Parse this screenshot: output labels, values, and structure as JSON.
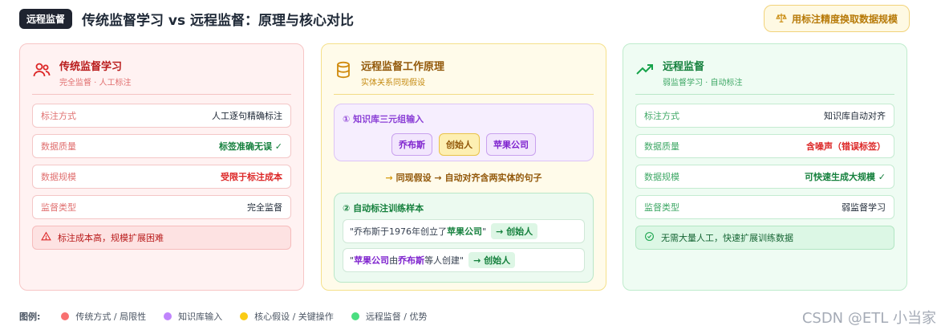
{
  "header": {
    "badge": "远程监督",
    "title": "传统监督学习 vs 远程监督：原理与核心对比",
    "tradeoff": "用标注精度换取数据规模",
    "tradeoff_icon": "scale-icon"
  },
  "traditional": {
    "icon": "users-icon",
    "title": "传统监督学习",
    "subtitle": "完全监督 · 人工标注",
    "rows": [
      {
        "key": "标注方式",
        "value": "人工逐句精确标注",
        "tone": "normal"
      },
      {
        "key": "数据质量",
        "value": "标签准确无误 ✓",
        "tone": "good"
      },
      {
        "key": "数据规模",
        "value": "受限于标注成本",
        "tone": "bad"
      },
      {
        "key": "监督类型",
        "value": "完全监督",
        "tone": "normal"
      }
    ],
    "note": "标注成本高，规模扩展困难"
  },
  "principle": {
    "icon": "database-icon",
    "title": "远程监督工作原理",
    "subtitle": "实体关系同现假设",
    "kb_label": "① 知识库三元组输入",
    "kb_chips": [
      "乔布斯",
      "创始人",
      "苹果公司"
    ],
    "assumption": "同现假设 → 自动对齐含两实体的句子",
    "samples_label": "② 自动标注训练样本",
    "samples": [
      {
        "pre": "\"乔布斯于1976年创立了",
        "ent": "苹果公司",
        "post": "\"",
        "relation": "→ 创始人"
      },
      {
        "pre": "\"",
        "ent": "苹果公司",
        "mid": "由",
        "ent2": "乔布斯",
        "post": "等人创建\"",
        "relation": "→ 创始人"
      }
    ]
  },
  "remote": {
    "icon": "trend-up-icon",
    "title": "远程监督",
    "subtitle": "弱监督学习 · 自动标注",
    "rows": [
      {
        "key": "标注方式",
        "value": "知识库自动对齐",
        "tone": "normal"
      },
      {
        "key": "数据质量",
        "value": "含噪声（错误标签）",
        "tone": "bad"
      },
      {
        "key": "数据规模",
        "value": "可快速生成大规模 ✓",
        "tone": "good"
      },
      {
        "key": "监督类型",
        "value": "弱监督学习",
        "tone": "normal"
      }
    ],
    "note": "无需大量人工，快速扩展训练数据"
  },
  "legend": {
    "title": "图例:",
    "items": [
      {
        "label": "传统方式 / 局限性",
        "color": "#f87171"
      },
      {
        "label": "知识库输入",
        "color": "#c084fc"
      },
      {
        "label": "核心假设 / 关键操作",
        "color": "#facc15"
      },
      {
        "label": "远程监督 / 优势",
        "color": "#4ade80"
      }
    ]
  },
  "watermark": "CSDN @ETL 小当家"
}
